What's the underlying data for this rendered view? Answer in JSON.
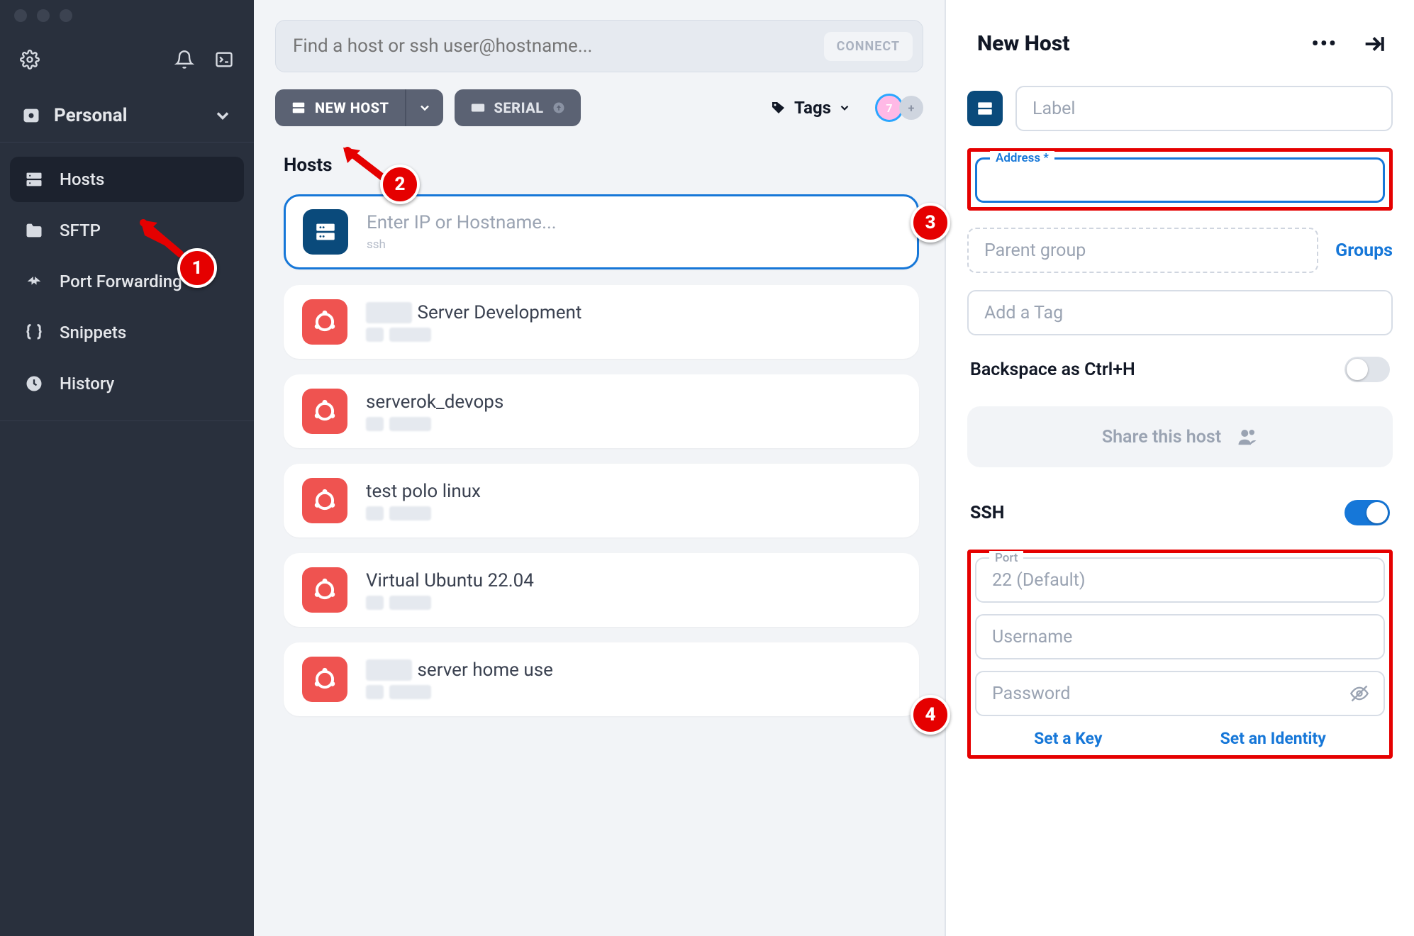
{
  "sidebar": {
    "vault_label": "Personal",
    "items": [
      {
        "label": "Hosts"
      },
      {
        "label": "SFTP"
      },
      {
        "label": "Port Forwarding"
      },
      {
        "label": "Snippets"
      },
      {
        "label": "History"
      }
    ]
  },
  "search": {
    "placeholder": "Find a host or ssh user@hostname...",
    "connect": "CONNECT"
  },
  "toolbar": {
    "new_host": "NEW HOST",
    "serial": "SERIAL",
    "tags": "Tags",
    "avatar_count": "7"
  },
  "hosts_heading": "Hosts",
  "new_host_row": {
    "title": "Enter IP or Hostname...",
    "sub": "ssh"
  },
  "hosts": [
    {
      "title_suffix": "Server Development",
      "has_blur_prefix": true
    },
    {
      "title_suffix": "serverok_devops",
      "has_blur_prefix": false
    },
    {
      "title_suffix": "test polo linux",
      "has_blur_prefix": false
    },
    {
      "title_suffix": "Virtual Ubuntu 22.04",
      "has_blur_prefix": false
    },
    {
      "title_suffix": "server home use",
      "has_blur_prefix": true
    }
  ],
  "panel": {
    "title": "New Host",
    "label_ph": "Label",
    "address_label": "Address *",
    "parent_group": "Parent group",
    "groups": "Groups",
    "tag_ph": "Add a Tag",
    "backspace": "Backspace as Ctrl+H",
    "share": "Share this host",
    "ssh": "SSH",
    "port_label": "Port",
    "port_ph": "22 (Default)",
    "user_ph": "Username",
    "pass_ph": "Password",
    "set_key": "Set a Key",
    "set_identity": "Set an Identity"
  },
  "annotations": {
    "b1": "1",
    "b2": "2",
    "b3": "3",
    "b4": "4"
  }
}
